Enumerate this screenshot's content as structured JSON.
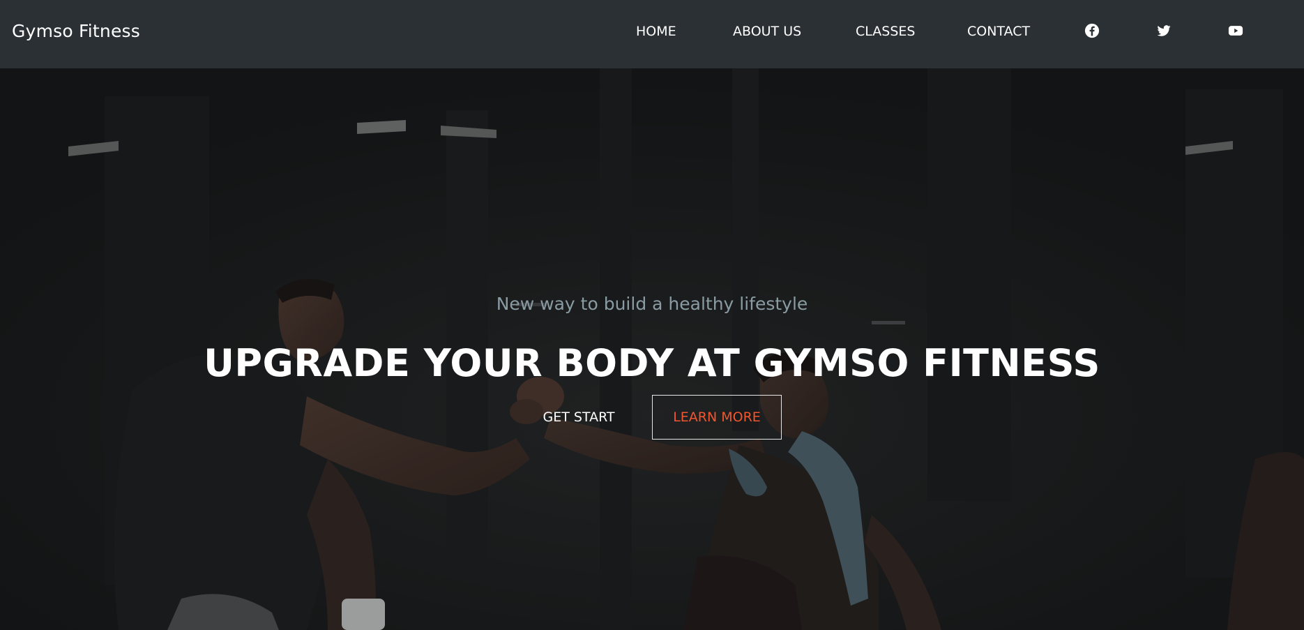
{
  "brand": {
    "name": "Gymso Fitness"
  },
  "nav": {
    "links": [
      {
        "label": "HOME"
      },
      {
        "label": "ABOUT US"
      },
      {
        "label": "CLASSES"
      },
      {
        "label": "CONTACT"
      }
    ],
    "social_icons": [
      "facebook-icon",
      "twitter-icon",
      "youtube-icon"
    ]
  },
  "hero": {
    "subtitle": "New way to build a healthy lifestyle",
    "headline": "UPGRADE YOUR BODY AT GYMSO FITNESS",
    "get_start_label": "GET START",
    "learn_more_label": "LEARN MORE",
    "background_image": "people-arm-wrestling-in-gym-photo"
  },
  "colors": {
    "navbar_bg": "#2b3035",
    "hero_overlay": "#17191c",
    "accent": "#f2562f",
    "subtitle": "#8a9ca3",
    "text": "#ffffff"
  }
}
